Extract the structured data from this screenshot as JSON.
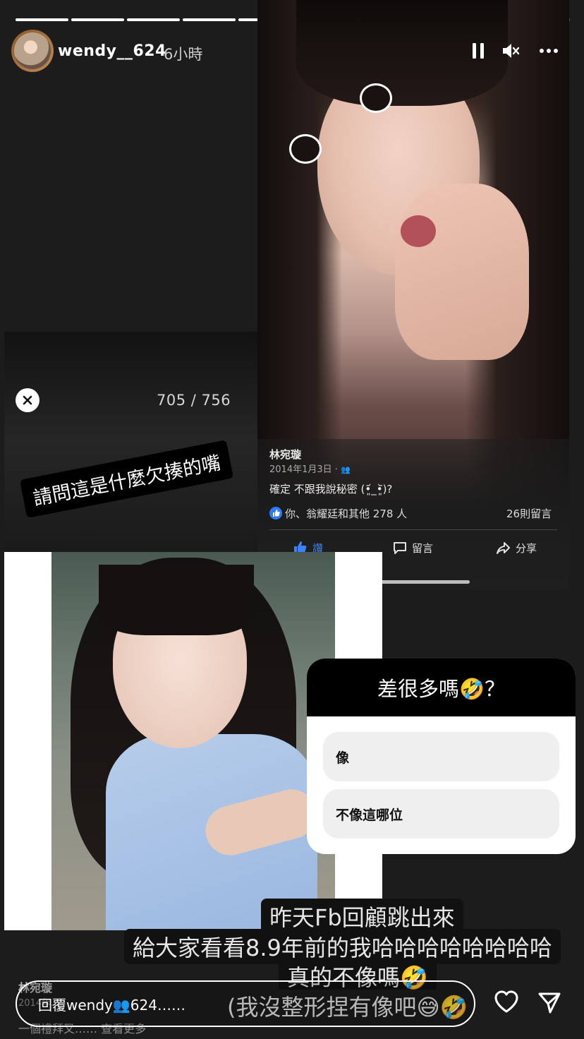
{
  "header": {
    "username": "wendy__624",
    "time": "6小時",
    "progress": {
      "total": 10,
      "completed": 8,
      "current_index": 9
    }
  },
  "top_post": {
    "name": "林宛璇",
    "date": "2014年1月3日 ·",
    "caption": "確定 不跟我說秘密 (•͈᷄_•͈᷅)?",
    "likes": "你、翁耀廷和其他 278 人",
    "comments": "26則留言",
    "actions": {
      "like": "讚",
      "comment": "留言",
      "share": "分享"
    }
  },
  "viewer": {
    "counter": "705 / 756"
  },
  "sticker_text": "請問這是什麼欠揍的嘴",
  "poll": {
    "question": "差很多嗎🤣？",
    "options": [
      "像",
      "不像這哪位"
    ]
  },
  "bottom_post": {
    "name": "林宛璇",
    "date": "2014年…",
    "text": "一個禮拜又…… 查看更多"
  },
  "captions": [
    "昨天Fb回顧跳出來",
    "給大家看看8.9年前的我哈哈哈哈哈哈哈哈",
    "真的不像嗎🤣",
    "(我沒整形捏有像吧😅🤣"
  ],
  "reply": {
    "placeholder": "回覆wendy👥624……"
  },
  "colors": {
    "fb_blue": "#2d7cf6",
    "background": "#1c1c1c"
  }
}
